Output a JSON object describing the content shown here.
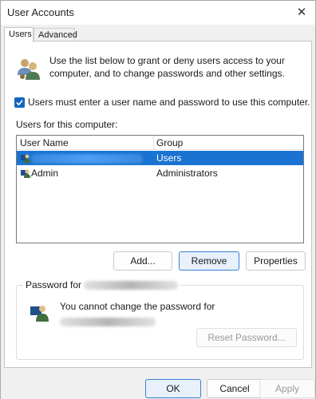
{
  "window": {
    "title": "User Accounts",
    "close_glyph": "✕"
  },
  "tabs": [
    {
      "label": "Users",
      "active": true
    },
    {
      "label": "Advanced",
      "active": false
    }
  ],
  "intro": {
    "icon": "users-icon",
    "text": "Use the list below to grant or deny users access to your computer, and to change passwords and other settings."
  },
  "require_login": {
    "checked": true,
    "label": "Users must enter a user name and password to use this computer."
  },
  "users_label": "Users for this computer:",
  "user_list": {
    "columns": [
      "User Name",
      "Group"
    ],
    "rows": [
      {
        "name": "",
        "group": "Users",
        "selected": true,
        "icon": "user-account-icon"
      },
      {
        "name": "Admin",
        "group": "Administrators",
        "selected": false,
        "icon": "user-account-icon"
      }
    ]
  },
  "actions": {
    "add": "Add...",
    "remove": "Remove",
    "properties": "Properties"
  },
  "password_group": {
    "legend_prefix": "Password for",
    "message": "You cannot change the password for",
    "reset_button": "Reset Password...",
    "icon": "password-user-icon"
  },
  "footer": {
    "ok": "OK",
    "cancel": "Cancel",
    "apply": "Apply"
  },
  "colors": {
    "selection": "#1a73d1",
    "checkbox": "#1565c0",
    "focus_border": "#3b7fd0"
  }
}
